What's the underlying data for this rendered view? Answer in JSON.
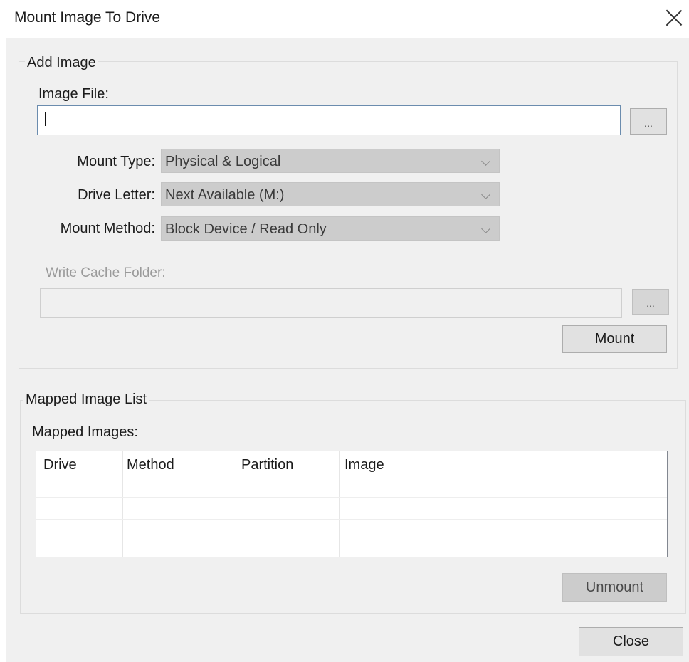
{
  "window": {
    "title": "Mount Image To Drive"
  },
  "add_image": {
    "legend": "Add Image",
    "image_file_label": "Image File:",
    "image_file_value": "",
    "browse_label": "...",
    "mount_type_label": "Mount Type:",
    "mount_type_value": "Physical & Logical",
    "drive_letter_label": "Drive Letter:",
    "drive_letter_value": "Next Available (M:)",
    "mount_method_label": "Mount Method:",
    "mount_method_value": "Block Device / Read Only",
    "write_cache_label": "Write Cache Folder:",
    "write_cache_value": "",
    "write_cache_browse_label": "...",
    "mount_button": "Mount"
  },
  "mapped": {
    "legend": "Mapped Image List",
    "images_label": "Mapped Images:",
    "columns": [
      "Drive",
      "Method",
      "Partition",
      "Image"
    ],
    "rows": [],
    "unmount_button": "Unmount"
  },
  "footer": {
    "close_button": "Close"
  },
  "icons": {
    "close": "close-icon",
    "chevron": "chevron-down-icon"
  }
}
